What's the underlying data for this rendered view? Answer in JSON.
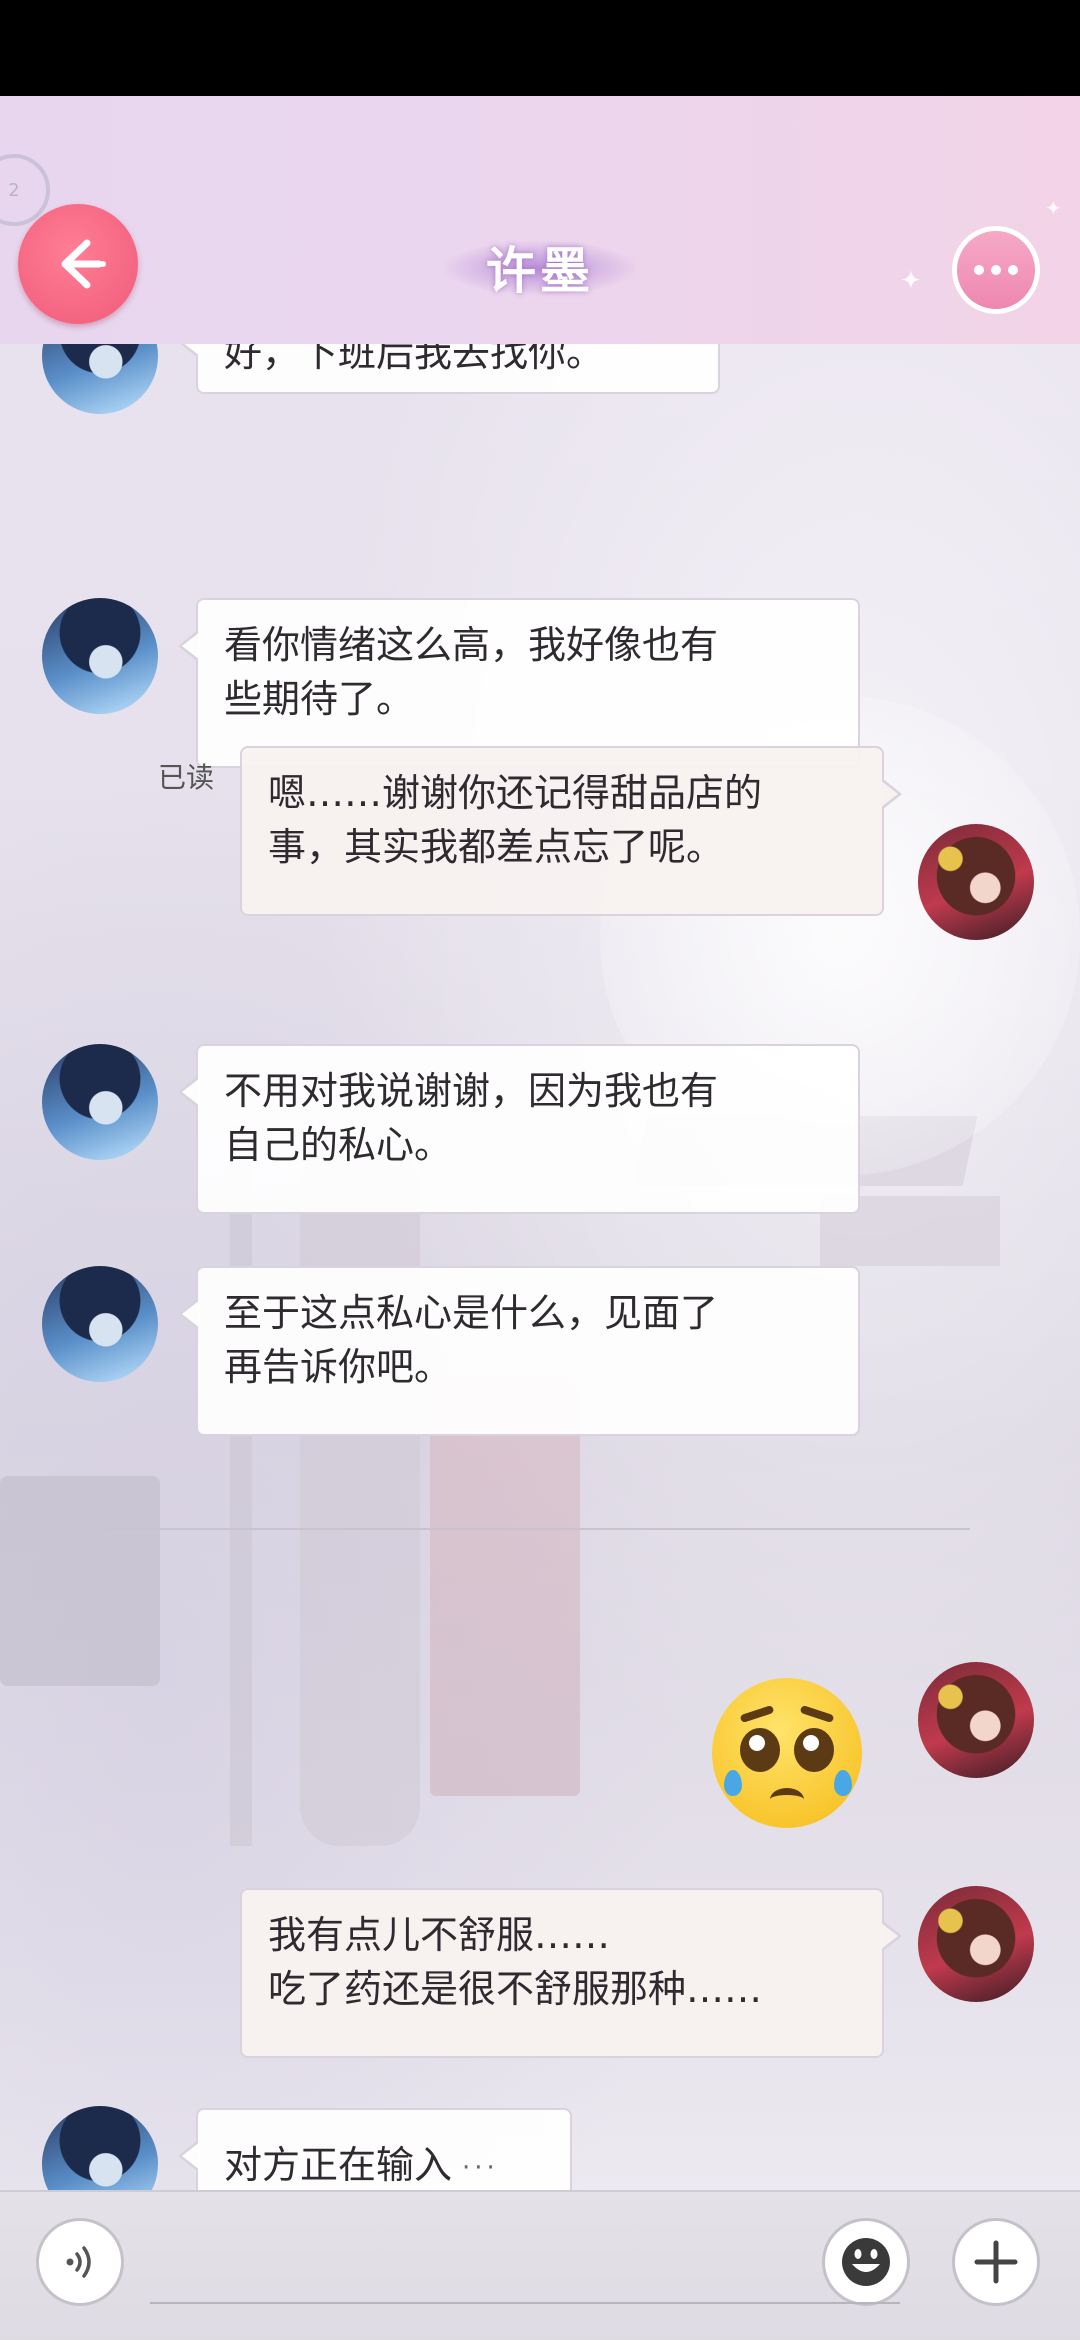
{
  "header": {
    "title": "许墨",
    "corner_badge": "2"
  },
  "messages": [
    {
      "side": "in",
      "text": "好，下班后我去找你。"
    },
    {
      "side": "in",
      "text": "看你情绪这么高，我好像也有\n些期待了。"
    },
    {
      "side": "out",
      "read": "已读",
      "text": "嗯……谢谢你还记得甜品店的\n事，其实我都差点忘了呢。"
    },
    {
      "side": "in",
      "text": "不用对我说谢谢，因为我也有\n自己的私心。"
    },
    {
      "side": "in",
      "text": "至于这点私心是什么，见面了\n再告诉你吧。"
    },
    {
      "side": "out",
      "type": "emoji",
      "emoji": "pleading-face"
    },
    {
      "side": "out",
      "text": "我有点儿不舒服……\n吃了药还是很不舒服那种……"
    },
    {
      "side": "in",
      "text": "对方正在输入",
      "typing": "···"
    }
  ],
  "input_bar": {
    "voice_icon": "voice-icon",
    "emoji_icon": "emoji-icon",
    "add_icon": "plus-icon"
  },
  "colors": {
    "back_button": "#f05a78",
    "more_button": "#ee87b0",
    "header_bg": "#e8d6ef"
  }
}
